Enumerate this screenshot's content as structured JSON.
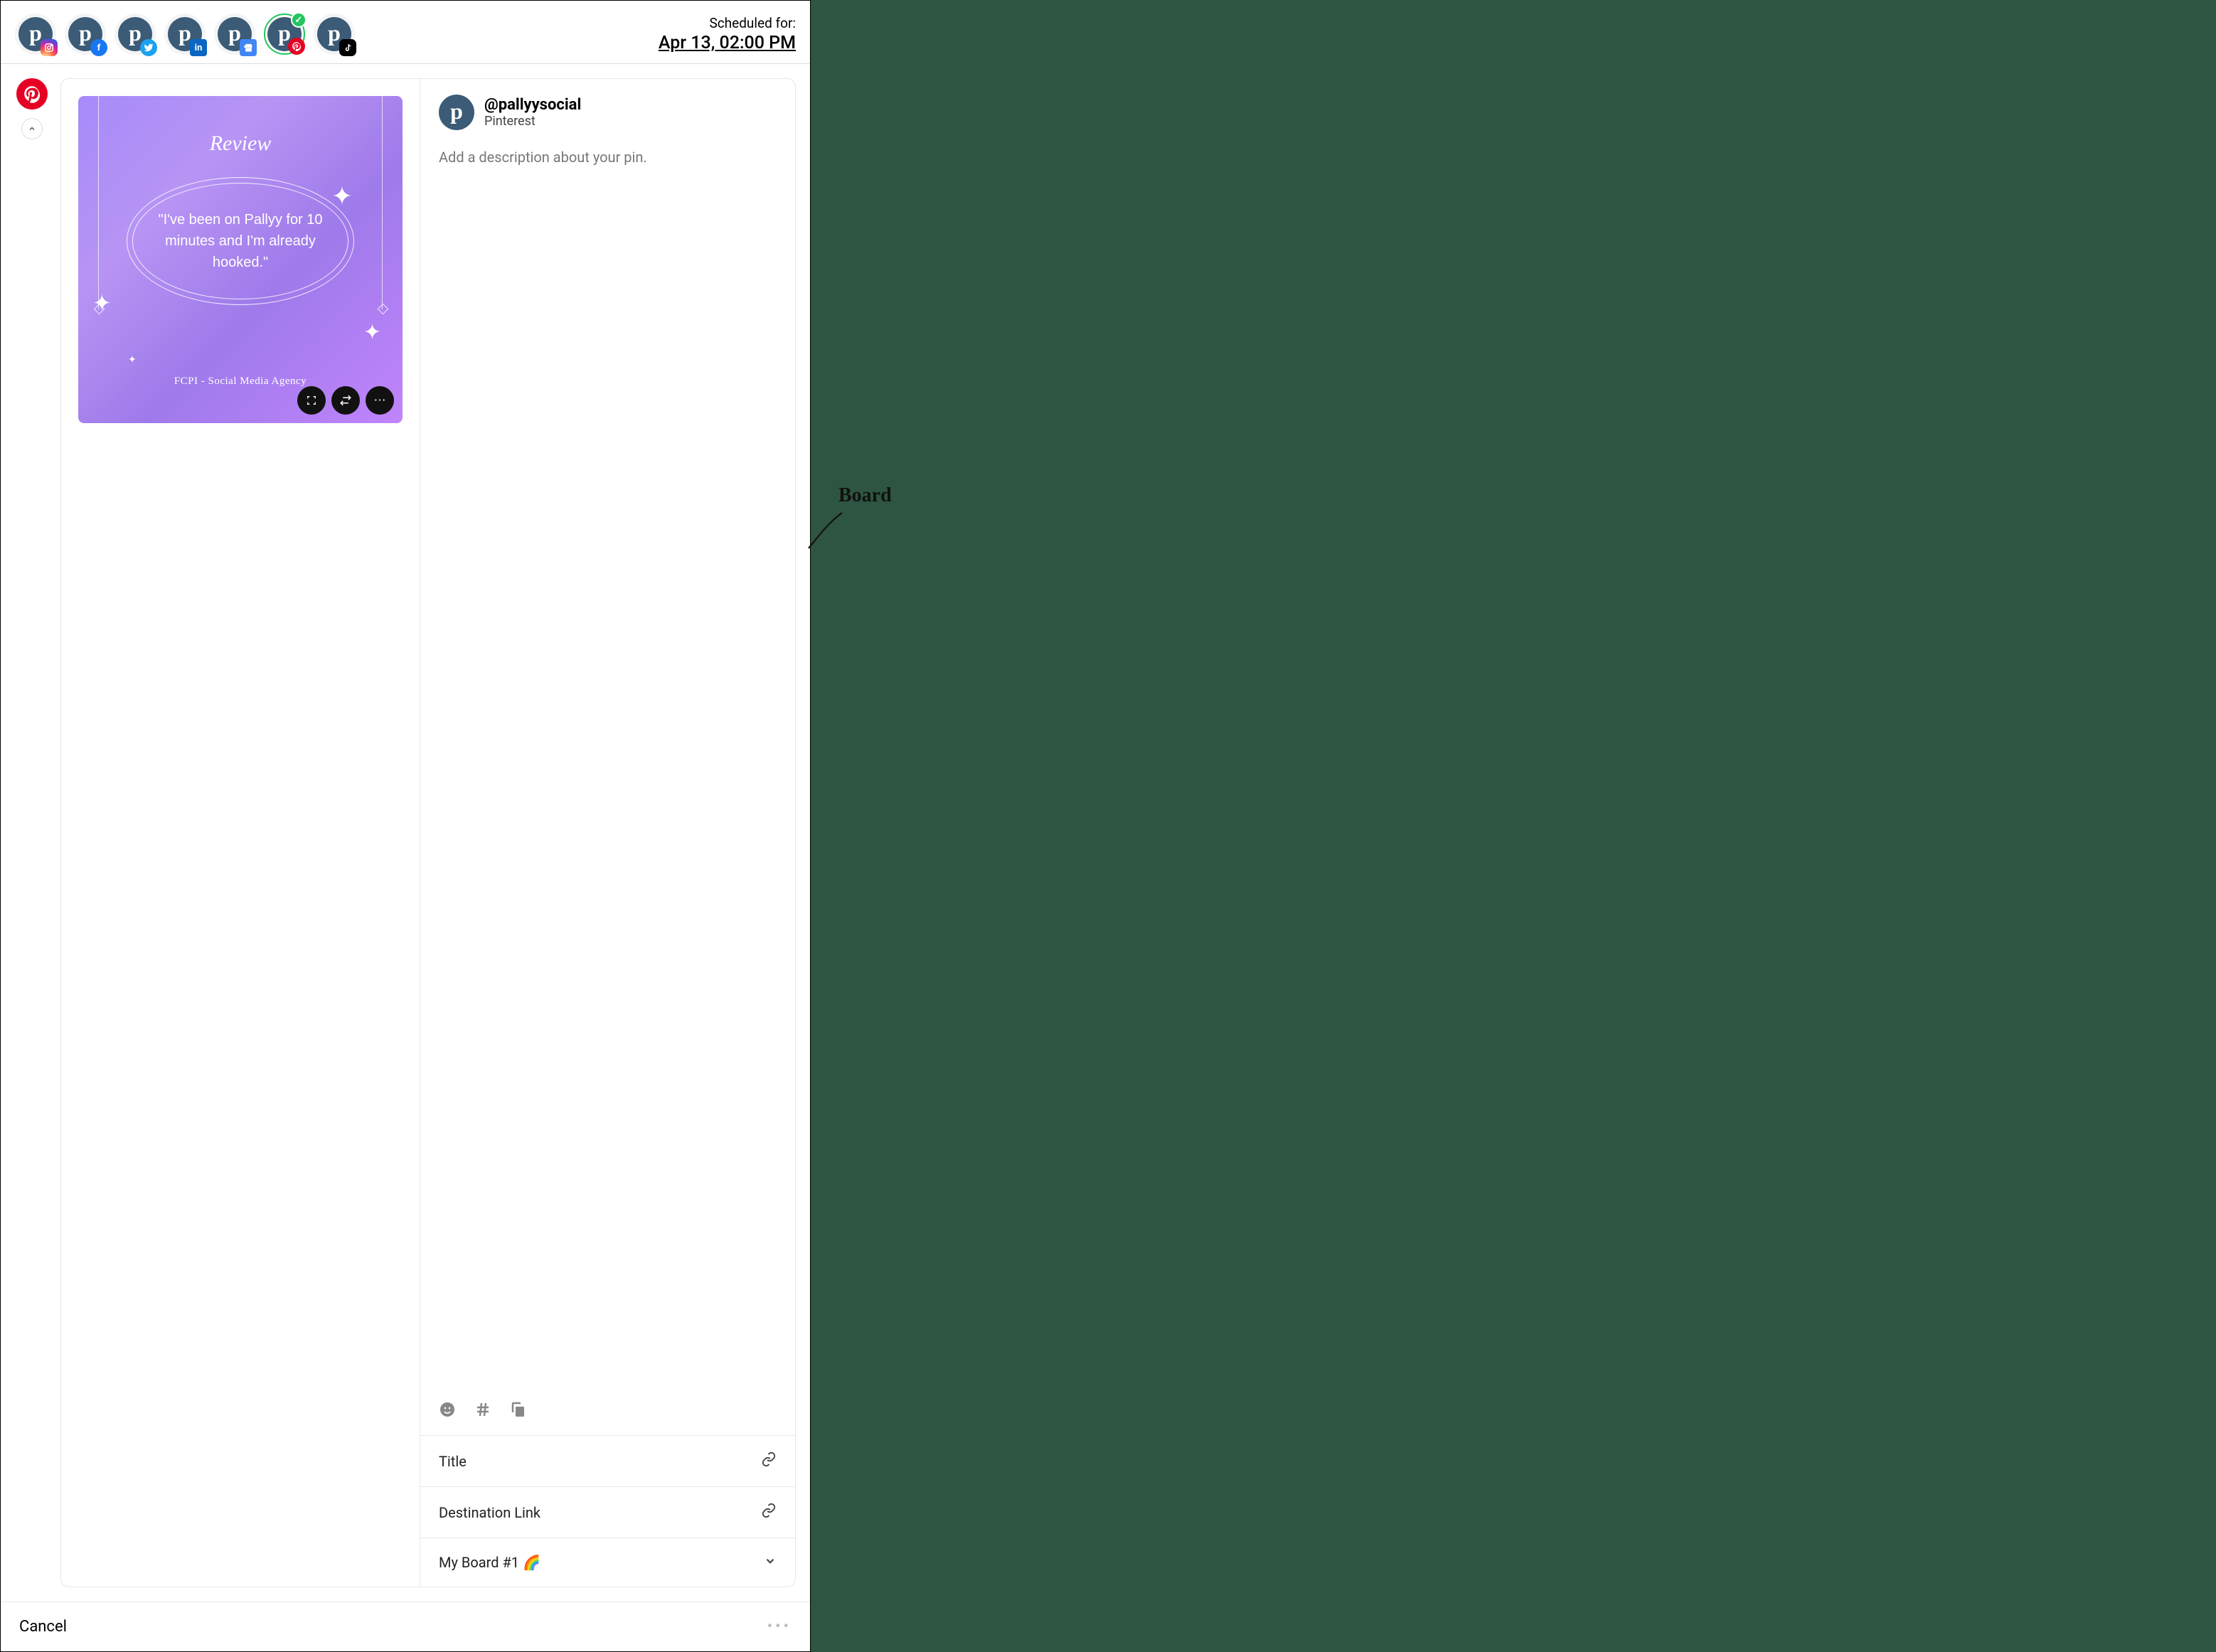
{
  "header": {
    "scheduled_label": "Scheduled for:",
    "scheduled_time": "Apr 13, 02:00 PM",
    "accounts": [
      {
        "network": "instagram"
      },
      {
        "network": "facebook"
      },
      {
        "network": "twitter"
      },
      {
        "network": "linkedin"
      },
      {
        "network": "google-my-business"
      },
      {
        "network": "pinterest",
        "active": true
      },
      {
        "network": "tiktok"
      }
    ]
  },
  "sidebar": {
    "active_network": "pinterest"
  },
  "media": {
    "title": "Review",
    "quote": "\"I've been on Pallyy for 10 minutes and I'm already hooked.\"",
    "attribution": "FCPI - Social Media Agency"
  },
  "form": {
    "handle": "@pallyysocial",
    "network_label": "Pinterest",
    "description_placeholder": "Add a description about your pin.",
    "title_label": "Title",
    "destination_label": "Destination Link",
    "board_value": "My Board #1 🌈"
  },
  "footer": {
    "cancel_label": "Cancel"
  },
  "annotation": {
    "label": "Board"
  }
}
